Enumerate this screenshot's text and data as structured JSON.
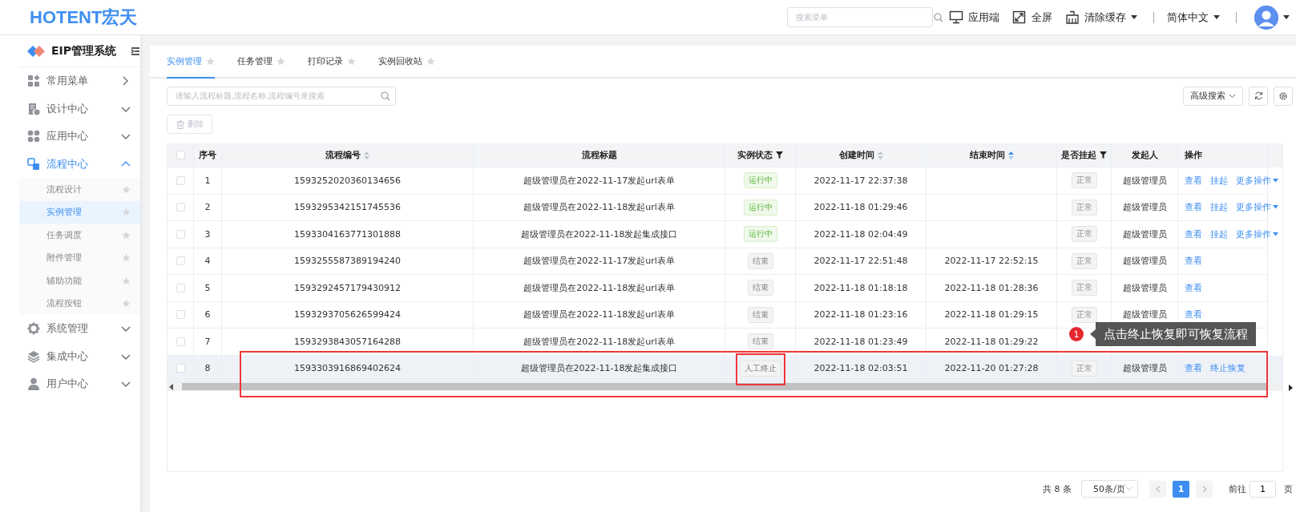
{
  "header": {
    "logo": "HOTENT宏天",
    "menu_search": {
      "placeholder": "搜索菜单"
    },
    "actions": [
      {
        "kind": "monitor",
        "label": "应用端",
        "dropdown": false
      },
      {
        "kind": "fullscreen",
        "label": "全屏",
        "dropdown": false
      },
      {
        "kind": "broom",
        "label": "清除缓存",
        "dropdown": true
      }
    ],
    "language": {
      "label": "简体中文"
    }
  },
  "sidebar": {
    "title": "EIP管理系统",
    "items": [
      {
        "kind": "link",
        "label": "常用菜单",
        "selected": false,
        "expanded": false
      },
      {
        "kind": "group",
        "label": "设计中心",
        "selected": false,
        "expanded": false
      },
      {
        "kind": "group",
        "label": "应用中心",
        "selected": false,
        "expanded": false
      },
      {
        "kind": "group",
        "label": "流程中心",
        "selected": true,
        "expanded": true,
        "children": [
          {
            "label": "流程设计",
            "selected": false
          },
          {
            "label": "实例管理",
            "selected": true
          },
          {
            "label": "任务调度",
            "selected": false
          },
          {
            "label": "附件管理",
            "selected": false
          },
          {
            "label": "辅助功能",
            "selected": false
          },
          {
            "label": "流程按钮",
            "selected": false
          }
        ]
      },
      {
        "kind": "group",
        "label": "系统管理",
        "selected": false,
        "expanded": false
      },
      {
        "kind": "group",
        "label": "集成中心",
        "selected": false,
        "expanded": false
      },
      {
        "kind": "group",
        "label": "用户中心",
        "selected": false,
        "expanded": false
      }
    ]
  },
  "tabs": [
    {
      "label": "实例管理",
      "selected": true
    },
    {
      "label": "任务管理",
      "selected": false
    },
    {
      "label": "打印记录",
      "selected": false
    },
    {
      "label": "实例回收站",
      "selected": false
    }
  ],
  "toolbar": {
    "search": {
      "placeholder": "请输入流程标题,流程名称,流程编号来搜索"
    },
    "delete_button": {
      "label": "删除",
      "disabled": true
    },
    "advanced_search": "高级搜索"
  },
  "table": {
    "all_checked": false,
    "columns": [
      {
        "label": "序号",
        "sortable": false,
        "sorted_ascending": false,
        "filter": false
      },
      {
        "label": "流程编号",
        "sortable": true,
        "sorted_ascending": false,
        "filter": false
      },
      {
        "label": "流程标题",
        "sortable": false,
        "sorted_ascending": false,
        "filter": false
      },
      {
        "label": "实例状态",
        "sortable": false,
        "sorted_ascending": false,
        "filter": true
      },
      {
        "label": "创建时间",
        "sortable": true,
        "sorted_ascending": false,
        "filter": false
      },
      {
        "label": "结束时间",
        "sortable": true,
        "sorted_ascending": true,
        "filter": false
      },
      {
        "label": "是否挂起",
        "sortable": false,
        "sorted_ascending": false,
        "filter": true
      },
      {
        "label": "发起人",
        "sortable": false,
        "sorted_ascending": false,
        "filter": false
      },
      {
        "label": "操作",
        "sortable": false,
        "sorted_ascending": false,
        "filter": false
      }
    ],
    "rows": [
      {
        "index": "1",
        "number": "1593252020360134656",
        "title": "超级管理员在2022-11-17发起url表单",
        "status": {
          "label": "运行中",
          "kind": "running",
          "marked": false
        },
        "created": "2022-11-17 22:37:38",
        "suspended": "正常",
        "initiator": "超级管理员",
        "actions": [
          {
            "label": "查看",
            "dropdown": false
          },
          {
            "label": "挂起",
            "dropdown": false
          },
          {
            "label": "更多操作",
            "dropdown": true
          }
        ],
        "checked": false,
        "hovered": false,
        "marked": false
      },
      {
        "index": "2",
        "number": "1593295342151745536",
        "title": "超级管理员在2022-11-18发起url表单",
        "status": {
          "label": "运行中",
          "kind": "running",
          "marked": false
        },
        "created": "2022-11-18 01:29:46",
        "suspended": "正常",
        "initiator": "超级管理员",
        "actions": [
          {
            "label": "查看",
            "dropdown": false
          },
          {
            "label": "挂起",
            "dropdown": false
          },
          {
            "label": "更多操作",
            "dropdown": true
          }
        ],
        "checked": false,
        "hovered": false,
        "marked": false
      },
      {
        "index": "3",
        "number": "1593304163771301888",
        "title": "超级管理员在2022-11-18发起集成接口",
        "status": {
          "label": "运行中",
          "kind": "running",
          "marked": false
        },
        "created": "2022-11-18 02:04:49",
        "suspended": "正常",
        "initiator": "超级管理员",
        "actions": [
          {
            "label": "查看",
            "dropdown": false
          },
          {
            "label": "挂起",
            "dropdown": false
          },
          {
            "label": "更多操作",
            "dropdown": true
          }
        ],
        "checked": false,
        "hovered": false,
        "marked": false
      },
      {
        "index": "4",
        "number": "1593255587389194240",
        "title": "超级管理员在2022-11-17发起url表单",
        "status": {
          "label": "结束",
          "kind": "ended",
          "marked": false
        },
        "created": "2022-11-17 22:51:48",
        "ended": "2022-11-17 22:52:15",
        "suspended": "正常",
        "initiator": "超级管理员",
        "actions": [
          {
            "label": "查看",
            "dropdown": false
          }
        ],
        "checked": false,
        "hovered": false,
        "marked": false
      },
      {
        "index": "5",
        "number": "1593292457179430912",
        "title": "超级管理员在2022-11-18发起url表单",
        "status": {
          "label": "结束",
          "kind": "ended",
          "marked": false
        },
        "created": "2022-11-18 01:18:18",
        "ended": "2022-11-18 01:28:36",
        "suspended": "正常",
        "initiator": "超级管理员",
        "actions": [
          {
            "label": "查看",
            "dropdown": false
          }
        ],
        "checked": false,
        "hovered": false,
        "marked": false
      },
      {
        "index": "6",
        "number": "1593293705626599424",
        "title": "超级管理员在2022-11-18发起url表单",
        "status": {
          "label": "结束",
          "kind": "ended",
          "marked": false
        },
        "created": "2022-11-18 01:23:16",
        "ended": "2022-11-18 01:29:15",
        "suspended": "正常",
        "initiator": "超级管理员",
        "actions": [
          {
            "label": "查看",
            "dropdown": false
          }
        ],
        "checked": false,
        "hovered": false,
        "marked": false
      },
      {
        "index": "7",
        "number": "1593293843057164288",
        "title": "超级管理员在2022-11-18发起url表单",
        "status": {
          "label": "结束",
          "kind": "ended",
          "marked": false
        },
        "created": "2022-11-18 01:23:49",
        "ended": "2022-11-18 01:29:22",
        "actions": [],
        "checked": false,
        "hovered": false,
        "marked": false
      },
      {
        "index": "8",
        "number": "1593303916869402624",
        "title": "超级管理员在2022-11-18发起集成接口",
        "status": {
          "label": "人工终止",
          "kind": "terminated",
          "marked": true
        },
        "created": "2022-11-18 02:03:51",
        "ended": "2022-11-20 01:27:28",
        "suspended": "正常",
        "initiator": "超级管理员",
        "actions": [
          {
            "label": "查看",
            "dropdown": false
          },
          {
            "label": "终止恢复",
            "dropdown": false
          }
        ],
        "checked": false,
        "hovered": true,
        "marked": true
      }
    ]
  },
  "callout": {
    "badge": "1",
    "text": "点击终止恢复即可恢复流程"
  },
  "pagination": {
    "total": "共 8 条",
    "page_size": "50条/页",
    "pages": [
      {
        "label": "1",
        "selected": true
      }
    ],
    "goto_label": "前往",
    "goto_value": "1",
    "page_suffix": "页"
  }
}
